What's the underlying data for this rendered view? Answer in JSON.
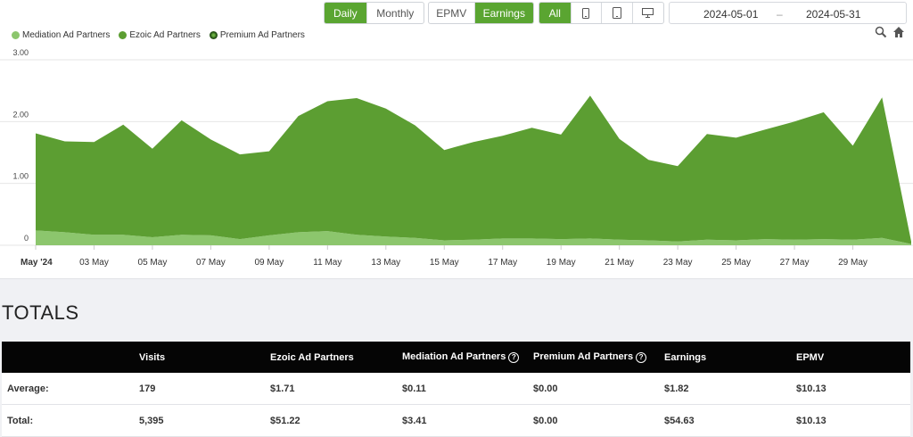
{
  "controls": {
    "period": [
      {
        "label": "Daily",
        "active": true
      },
      {
        "label": "Monthly",
        "active": false
      }
    ],
    "metric": [
      {
        "label": "EPMV",
        "active": false
      },
      {
        "label": "Earnings",
        "active": true
      }
    ],
    "device": [
      {
        "label": "All",
        "active": true,
        "icon": ""
      },
      {
        "label": "",
        "active": false,
        "icon": "mobile-icon"
      },
      {
        "label": "",
        "active": false,
        "icon": "tablet-icon"
      },
      {
        "label": "",
        "active": false,
        "icon": "desktop-icon"
      }
    ],
    "date_start": "2024-05-01",
    "date_sep": "–",
    "date_end": "2024-05-31"
  },
  "chart_data": {
    "type": "area",
    "stacked": true,
    "title": "",
    "xlabel": "",
    "ylabel": "",
    "ylim": [
      0,
      3
    ],
    "y_ticks": [
      "0",
      "1.00",
      "2.00",
      "3.00"
    ],
    "grid": true,
    "legend_position": "top-left",
    "x_tick_labels": [
      "May '24",
      "03 May",
      "05 May",
      "07 May",
      "09 May",
      "11 May",
      "13 May",
      "15 May",
      "17 May",
      "19 May",
      "21 May",
      "23 May",
      "25 May",
      "27 May",
      "29 May"
    ],
    "x": [
      "2024-05-01",
      "2024-05-02",
      "2024-05-03",
      "2024-05-04",
      "2024-05-05",
      "2024-05-06",
      "2024-05-07",
      "2024-05-08",
      "2024-05-09",
      "2024-05-10",
      "2024-05-11",
      "2024-05-12",
      "2024-05-13",
      "2024-05-14",
      "2024-05-15",
      "2024-05-16",
      "2024-05-17",
      "2024-05-18",
      "2024-05-19",
      "2024-05-20",
      "2024-05-21",
      "2024-05-22",
      "2024-05-23",
      "2024-05-24",
      "2024-05-25",
      "2024-05-26",
      "2024-05-27",
      "2024-05-28",
      "2024-05-29",
      "2024-05-30",
      "2024-05-31"
    ],
    "series": [
      {
        "name": "Mediation Ad Partners",
        "color": "#8cc66d",
        "values": [
          0.24,
          0.21,
          0.17,
          0.17,
          0.13,
          0.17,
          0.16,
          0.1,
          0.16,
          0.21,
          0.23,
          0.17,
          0.14,
          0.12,
          0.08,
          0.09,
          0.11,
          0.11,
          0.1,
          0.11,
          0.09,
          0.08,
          0.06,
          0.09,
          0.08,
          0.1,
          0.09,
          0.1,
          0.09,
          0.12,
          0.02
        ]
      },
      {
        "name": "Ezoic Ad Partners",
        "color": "#5c9e32",
        "values": [
          1.57,
          1.47,
          1.5,
          1.78,
          1.43,
          1.85,
          1.55,
          1.37,
          1.36,
          1.88,
          2.1,
          2.21,
          2.07,
          1.82,
          1.46,
          1.58,
          1.66,
          1.79,
          1.69,
          2.31,
          1.63,
          1.3,
          1.22,
          1.71,
          1.66,
          1.77,
          1.91,
          2.05,
          1.52,
          2.27,
          0.04
        ]
      },
      {
        "name": "Premium Ad Partners",
        "color": "#2e5e1c",
        "values": [
          0,
          0,
          0,
          0,
          0,
          0,
          0,
          0,
          0,
          0,
          0,
          0,
          0,
          0,
          0,
          0,
          0,
          0,
          0,
          0,
          0,
          0,
          0,
          0,
          0,
          0,
          0,
          0,
          0,
          0,
          0
        ]
      }
    ]
  },
  "totals": {
    "title": "TOTALS",
    "columns": [
      {
        "label": "",
        "help": false
      },
      {
        "label": "Visits",
        "help": false
      },
      {
        "label": "Ezoic Ad Partners",
        "help": false
      },
      {
        "label": "Mediation Ad Partners",
        "help": true
      },
      {
        "label": "Premium Ad Partners",
        "help": true
      },
      {
        "label": "Earnings",
        "help": false
      },
      {
        "label": "EPMV",
        "help": false
      }
    ],
    "rows": [
      [
        "Average:",
        "179",
        "$1.71",
        "$0.11",
        "$0.00",
        "$1.82",
        "$10.13"
      ],
      [
        "Total:",
        "5,395",
        "$51.22",
        "$3.41",
        "$0.00",
        "$54.63",
        "$10.13"
      ]
    ]
  }
}
